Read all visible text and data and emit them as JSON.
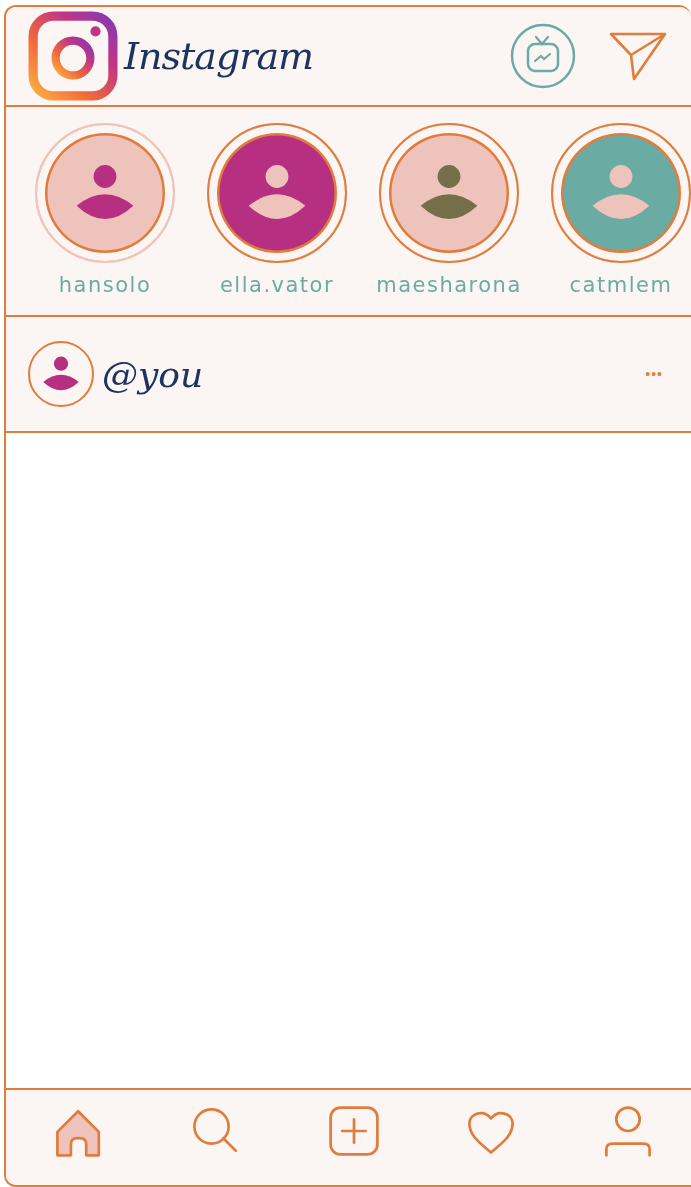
{
  "header": {
    "logo_text": "Instagram"
  },
  "stories": [
    {
      "name": "hansolo",
      "seen": true,
      "color": "#eec3bb",
      "figure": {
        "color": "#b72f80"
      }
    },
    {
      "name": "ella.vator",
      "seen": false,
      "color": "#b72f80",
      "figure": {
        "color": "#eec3bb"
      }
    },
    {
      "name": "maesharona",
      "seen": false,
      "color": "#eec3bb",
      "figure": {
        "color": "#746f48"
      }
    },
    {
      "name": "catmlem",
      "seen": false,
      "color": "#6aaca3",
      "figure": {
        "color": "#eec3bb"
      }
    }
  ],
  "post": {
    "username": "@you",
    "menu": "•••"
  },
  "nav": [
    {
      "kind": "home",
      "selected": true
    },
    {
      "kind": "search",
      "selected": false
    },
    {
      "kind": "add",
      "selected": false
    },
    {
      "kind": "heart",
      "selected": false
    },
    {
      "kind": "profile",
      "selected": false
    }
  ]
}
